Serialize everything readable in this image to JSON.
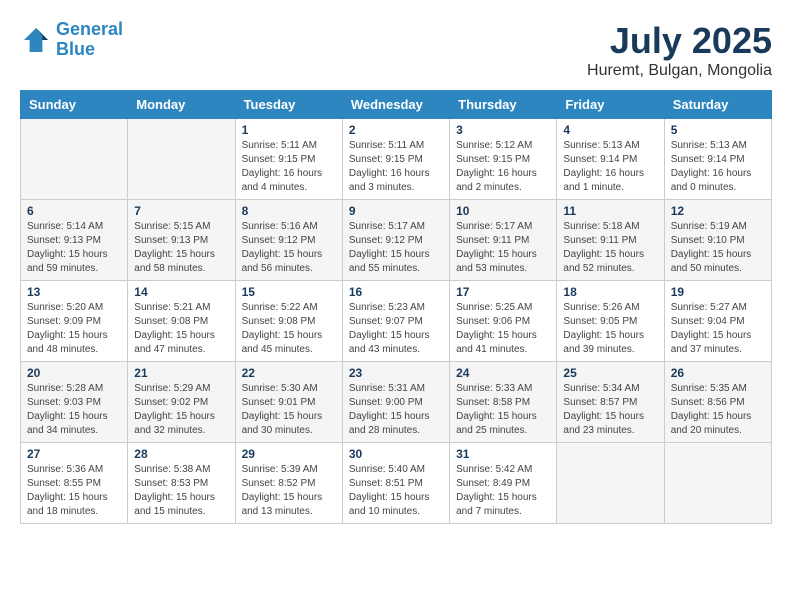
{
  "header": {
    "logo_line1": "General",
    "logo_line2": "Blue",
    "month_title": "July 2025",
    "location": "Huremt, Bulgan, Mongolia"
  },
  "days_of_week": [
    "Sunday",
    "Monday",
    "Tuesday",
    "Wednesday",
    "Thursday",
    "Friday",
    "Saturday"
  ],
  "weeks": [
    {
      "days": [
        {
          "num": "",
          "info": ""
        },
        {
          "num": "",
          "info": ""
        },
        {
          "num": "1",
          "info": "Sunrise: 5:11 AM\nSunset: 9:15 PM\nDaylight: 16 hours\nand 4 minutes."
        },
        {
          "num": "2",
          "info": "Sunrise: 5:11 AM\nSunset: 9:15 PM\nDaylight: 16 hours\nand 3 minutes."
        },
        {
          "num": "3",
          "info": "Sunrise: 5:12 AM\nSunset: 9:15 PM\nDaylight: 16 hours\nand 2 minutes."
        },
        {
          "num": "4",
          "info": "Sunrise: 5:13 AM\nSunset: 9:14 PM\nDaylight: 16 hours\nand 1 minute."
        },
        {
          "num": "5",
          "info": "Sunrise: 5:13 AM\nSunset: 9:14 PM\nDaylight: 16 hours\nand 0 minutes."
        }
      ]
    },
    {
      "days": [
        {
          "num": "6",
          "info": "Sunrise: 5:14 AM\nSunset: 9:13 PM\nDaylight: 15 hours\nand 59 minutes."
        },
        {
          "num": "7",
          "info": "Sunrise: 5:15 AM\nSunset: 9:13 PM\nDaylight: 15 hours\nand 58 minutes."
        },
        {
          "num": "8",
          "info": "Sunrise: 5:16 AM\nSunset: 9:12 PM\nDaylight: 15 hours\nand 56 minutes."
        },
        {
          "num": "9",
          "info": "Sunrise: 5:17 AM\nSunset: 9:12 PM\nDaylight: 15 hours\nand 55 minutes."
        },
        {
          "num": "10",
          "info": "Sunrise: 5:17 AM\nSunset: 9:11 PM\nDaylight: 15 hours\nand 53 minutes."
        },
        {
          "num": "11",
          "info": "Sunrise: 5:18 AM\nSunset: 9:11 PM\nDaylight: 15 hours\nand 52 minutes."
        },
        {
          "num": "12",
          "info": "Sunrise: 5:19 AM\nSunset: 9:10 PM\nDaylight: 15 hours\nand 50 minutes."
        }
      ]
    },
    {
      "days": [
        {
          "num": "13",
          "info": "Sunrise: 5:20 AM\nSunset: 9:09 PM\nDaylight: 15 hours\nand 48 minutes."
        },
        {
          "num": "14",
          "info": "Sunrise: 5:21 AM\nSunset: 9:08 PM\nDaylight: 15 hours\nand 47 minutes."
        },
        {
          "num": "15",
          "info": "Sunrise: 5:22 AM\nSunset: 9:08 PM\nDaylight: 15 hours\nand 45 minutes."
        },
        {
          "num": "16",
          "info": "Sunrise: 5:23 AM\nSunset: 9:07 PM\nDaylight: 15 hours\nand 43 minutes."
        },
        {
          "num": "17",
          "info": "Sunrise: 5:25 AM\nSunset: 9:06 PM\nDaylight: 15 hours\nand 41 minutes."
        },
        {
          "num": "18",
          "info": "Sunrise: 5:26 AM\nSunset: 9:05 PM\nDaylight: 15 hours\nand 39 minutes."
        },
        {
          "num": "19",
          "info": "Sunrise: 5:27 AM\nSunset: 9:04 PM\nDaylight: 15 hours\nand 37 minutes."
        }
      ]
    },
    {
      "days": [
        {
          "num": "20",
          "info": "Sunrise: 5:28 AM\nSunset: 9:03 PM\nDaylight: 15 hours\nand 34 minutes."
        },
        {
          "num": "21",
          "info": "Sunrise: 5:29 AM\nSunset: 9:02 PM\nDaylight: 15 hours\nand 32 minutes."
        },
        {
          "num": "22",
          "info": "Sunrise: 5:30 AM\nSunset: 9:01 PM\nDaylight: 15 hours\nand 30 minutes."
        },
        {
          "num": "23",
          "info": "Sunrise: 5:31 AM\nSunset: 9:00 PM\nDaylight: 15 hours\nand 28 minutes."
        },
        {
          "num": "24",
          "info": "Sunrise: 5:33 AM\nSunset: 8:58 PM\nDaylight: 15 hours\nand 25 minutes."
        },
        {
          "num": "25",
          "info": "Sunrise: 5:34 AM\nSunset: 8:57 PM\nDaylight: 15 hours\nand 23 minutes."
        },
        {
          "num": "26",
          "info": "Sunrise: 5:35 AM\nSunset: 8:56 PM\nDaylight: 15 hours\nand 20 minutes."
        }
      ]
    },
    {
      "days": [
        {
          "num": "27",
          "info": "Sunrise: 5:36 AM\nSunset: 8:55 PM\nDaylight: 15 hours\nand 18 minutes."
        },
        {
          "num": "28",
          "info": "Sunrise: 5:38 AM\nSunset: 8:53 PM\nDaylight: 15 hours\nand 15 minutes."
        },
        {
          "num": "29",
          "info": "Sunrise: 5:39 AM\nSunset: 8:52 PM\nDaylight: 15 hours\nand 13 minutes."
        },
        {
          "num": "30",
          "info": "Sunrise: 5:40 AM\nSunset: 8:51 PM\nDaylight: 15 hours\nand 10 minutes."
        },
        {
          "num": "31",
          "info": "Sunrise: 5:42 AM\nSunset: 8:49 PM\nDaylight: 15 hours\nand 7 minutes."
        },
        {
          "num": "",
          "info": ""
        },
        {
          "num": "",
          "info": ""
        }
      ]
    }
  ]
}
